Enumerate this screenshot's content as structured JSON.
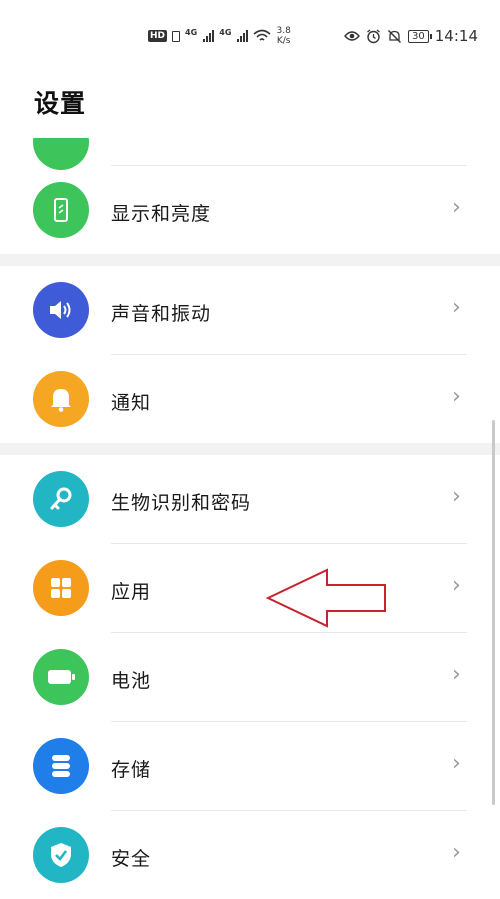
{
  "status_bar": {
    "network_1": "4G",
    "network_2": "4G",
    "speed_value": "3.8",
    "speed_unit": "K/s",
    "battery": "30",
    "time": "14:14"
  },
  "header": {
    "title": "设置"
  },
  "settings": {
    "items": [
      {
        "label": "显示和亮度",
        "icon": "phone-display-icon",
        "color": "#3dc45b"
      },
      {
        "label": "声音和振动",
        "icon": "speaker-icon",
        "color": "#3f5bd8"
      },
      {
        "label": "通知",
        "icon": "bell-icon",
        "color": "#f5a623"
      },
      {
        "label": "生物识别和密码",
        "icon": "key-icon",
        "color": "#22b6c4"
      },
      {
        "label": "应用",
        "icon": "apps-grid-icon",
        "color": "#f59d1b"
      },
      {
        "label": "电池",
        "icon": "battery-icon",
        "color": "#3dc45b"
      },
      {
        "label": "存储",
        "icon": "storage-icon",
        "color": "#1f7ee8"
      },
      {
        "label": "安全",
        "icon": "shield-icon",
        "color": "#22b6c4"
      }
    ],
    "chevron": "›"
  },
  "annotation": {
    "arrow_color": "#c8232c"
  }
}
